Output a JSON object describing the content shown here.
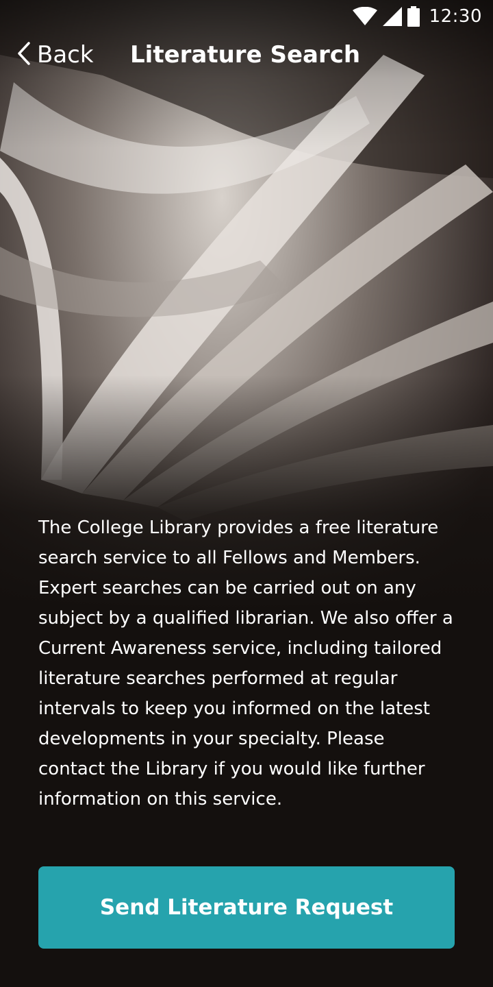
{
  "status_bar": {
    "time": "12:30",
    "icons": [
      "wifi-icon",
      "cellular-signal-icon",
      "battery-icon"
    ]
  },
  "nav": {
    "back_label": "Back",
    "back_icon": "chevron-left-icon",
    "title": "Literature Search"
  },
  "background": {
    "image": "open-book-pages-photo"
  },
  "content": {
    "description": "The College Library provides a free literature search service to all Fellows and Members. Expert searches can be carried out on any subject by a qualified librarian. We also offer a Current Awareness service, including tailored literature searches performed at regular intervals to keep you informed on the latest developments in your specialty. Please contact the Library if you would like further information on this service."
  },
  "actions": {
    "send_request_label": "Send Literature Request"
  },
  "colors": {
    "accent": "#26a3ad",
    "background_dark": "#14100e",
    "text": "#ffffff"
  }
}
